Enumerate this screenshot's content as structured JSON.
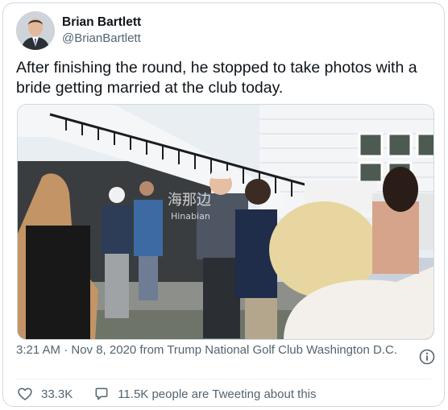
{
  "author": {
    "display_name": "Brian Bartlett",
    "handle": "@BrianBartlett"
  },
  "tweet": {
    "text": "After finishing the round, he stopped to take photos with a bride getting married at the club today.",
    "meta": "3:21 AM · Nov 8, 2020 from Trump National Golf Club Washington D.C."
  },
  "media": {
    "watermark_cn": "海那边",
    "watermark_en": "Hinabian"
  },
  "stats": {
    "likes": "33.3K",
    "talking": "11.5K people are Tweeting about this"
  },
  "icons": {
    "like": "heart-icon",
    "reply": "speech-bubble-icon",
    "info": "info-circle-icon"
  },
  "colors": {
    "text": "#0f1419",
    "secondary": "#536471",
    "border": "#cfd9de"
  }
}
